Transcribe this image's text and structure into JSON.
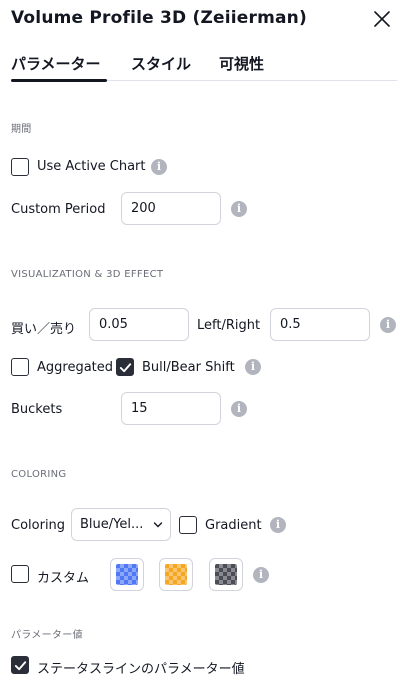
{
  "dialog": {
    "title": "Volume Profile 3D (Zeiierman)"
  },
  "tabs": [
    {
      "label": "パラメーター",
      "active": true
    },
    {
      "label": "スタイル"
    },
    {
      "label": "可視性"
    }
  ],
  "period": {
    "heading": "期間",
    "use_active_chart": {
      "label": "Use Active Chart",
      "checked": false
    },
    "custom_period": {
      "label": "Custom Period",
      "value": "200"
    }
  },
  "visualization": {
    "heading": "VISUALIZATION & 3D EFFECT",
    "buy_sell": {
      "label": "買い／売り",
      "value": "0.05"
    },
    "left_right": {
      "label": "Left/Right",
      "value": "0.5"
    },
    "aggregated": {
      "label": "Aggregated",
      "checked": false
    },
    "bull_bear_shift": {
      "label": "Bull/Bear Shift",
      "checked": true
    },
    "buckets": {
      "label": "Buckets",
      "value": "15"
    }
  },
  "coloring": {
    "heading": "COLORING",
    "coloring": {
      "label": "Coloring",
      "selected": "Blue/Yel..."
    },
    "gradient": {
      "label": "Gradient",
      "checked": false
    },
    "custom": {
      "label": "カスタム",
      "checked": false
    },
    "swatches": [
      {
        "name": "blue",
        "color": "#4f78f5"
      },
      {
        "name": "orange",
        "color": "#f5a623"
      },
      {
        "name": "dark-gray",
        "color": "#4a4d56"
      }
    ]
  },
  "param_values": {
    "heading": "パラメーター値",
    "status_line": {
      "label": "ステータスラインのパラメーター値",
      "checked": true
    }
  },
  "colors": {
    "text": "#131722",
    "muted": "#6a6d78",
    "border": "#d1d4dc",
    "info_icon": "#b2b5be"
  }
}
